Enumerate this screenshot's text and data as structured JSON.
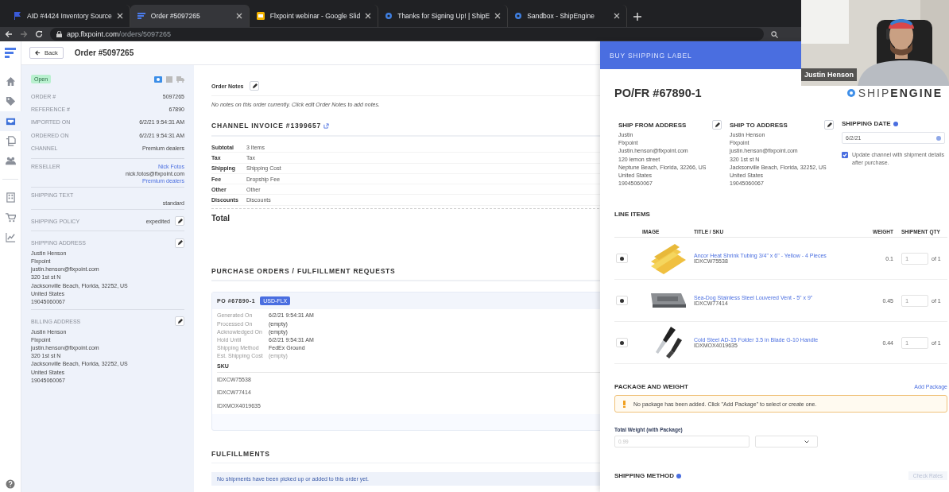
{
  "browser": {
    "tabs": [
      {
        "title": "AID #4424 Inventory Source",
        "kind": "flag",
        "selected": false
      },
      {
        "title": "Order #5097265",
        "kind": "flx",
        "selected": true
      },
      {
        "title": "Flxpoint webinar - Google Slid",
        "kind": "slides",
        "selected": false
      },
      {
        "title": "Thanks for Signing Up! | ShipE",
        "kind": "gear",
        "selected": false
      },
      {
        "title": "Sandbox - ShipEngine",
        "kind": "gear",
        "selected": false
      }
    ],
    "url_host": "app.flxpoint.com",
    "url_path": "/orders/5097265"
  },
  "rail": {
    "groups": [
      [
        {
          "kind": "home",
          "selected": false
        },
        {
          "kind": "tag",
          "selected": false
        },
        {
          "kind": "inbox",
          "selected": true
        },
        {
          "kind": "copy",
          "selected": false
        },
        {
          "kind": "users",
          "selected": false
        }
      ],
      [
        {
          "kind": "building",
          "selected": false
        },
        {
          "kind": "cart",
          "selected": false
        },
        {
          "kind": "chart",
          "selected": false
        }
      ]
    ]
  },
  "header": {
    "back": "Back",
    "title": "Order #5097265"
  },
  "details": {
    "status": "Open",
    "fields": [
      {
        "label": "ORDER #",
        "value": "5097265"
      },
      {
        "label": "REFERENCE #",
        "value": "67890"
      },
      {
        "label": "IMPORTED ON",
        "value": "6/2/21 9:54:31 AM"
      },
      {
        "label": "ORDERED ON",
        "value": "6/2/21 9:54:31 AM"
      },
      {
        "label": "CHANNEL",
        "value": "Premium dealers"
      }
    ],
    "reseller": {
      "label": "RESELLER",
      "name": "Nick Fotos",
      "email": "nick.fotos@flxpoint.com",
      "group": "Premium dealers"
    },
    "shipping_text": {
      "label": "SHIPPING TEXT",
      "value": "standard"
    },
    "shipping_policy": {
      "label": "SHIPPING POLICY",
      "value": "expedited"
    },
    "addresses": [
      {
        "label": "SHIPPING ADDRESS",
        "lines": [
          "Justin Henson",
          "Flxpoint",
          "justin.henson@flxpoint.com",
          "320 1st st N",
          "Jacksonville Beach, Florida, 32252, US",
          "United States",
          "19045060067"
        ]
      },
      {
        "label": "BILLING ADDRESS",
        "lines": [
          "Justin Henson",
          "Flxpoint",
          "justin.henson@flxpoint.com",
          "320 1st st N",
          "Jacksonville Beach, Florida, 32252, US",
          "United States",
          "19045060067"
        ]
      }
    ]
  },
  "main": {
    "order_notes": {
      "label": "Order Notes",
      "empty_text": "No notes on this order currently. Click edit Order Notes to add notes."
    },
    "invoice": {
      "title": "CHANNEL INVOICE #1399657",
      "rows": [
        {
          "label": "Subtotal",
          "value": "3 Items"
        },
        {
          "label": "Tax",
          "value": "Tax"
        },
        {
          "label": "Shipping",
          "value": "Shipping Cost"
        },
        {
          "label": "Fee",
          "value": "Dropship Fee"
        },
        {
          "label": "Other",
          "value": "Other"
        },
        {
          "label": "Discounts",
          "value": "Discounts"
        }
      ],
      "total_label": "Total"
    },
    "purchase_orders": {
      "title": "PURCHASE ORDERS / FULFILLMENT REQUESTS",
      "po": {
        "number": "PO #67890-1",
        "badge": "USD-FLX",
        "fields": [
          {
            "label": "Generated On",
            "value": "6/2/21 9:54:31 AM",
            "muted": false
          },
          {
            "label": "Processed On",
            "value": "(empty)",
            "muted": false
          },
          {
            "label": "Acknowledged On",
            "value": "(empty)",
            "muted": false
          },
          {
            "label": "Hold Until",
            "value": "6/2/21 9:54:31 AM",
            "muted": false
          },
          {
            "label": "Shipping Method",
            "value": "FedEx Ground",
            "muted": false
          },
          {
            "label": "Est. Shipping Cost",
            "value": "(empty)",
            "muted": true
          }
        ],
        "sku_header": "SKU",
        "skus": [
          "IDXCW75538",
          "IDXCW77414",
          "IDXMOX4019635"
        ]
      }
    },
    "fulfillments": {
      "title": "FULFILLMENTS",
      "empty_text": "No shipments have been picked up or added to this order yet."
    }
  },
  "drawer": {
    "title": "BUY SHIPPING LABEL",
    "po_title": "PO/FR #67890-1",
    "logo_a": "SHIP",
    "logo_b": "ENGINE",
    "ship_from": {
      "title": "SHIP FROM ADDRESS",
      "lines": [
        "Justin",
        "Flxpoint",
        "Justin.henson@flxpoint.com",
        "120 lemon street",
        "Neptune Beach, Florida, 32266, US",
        "United States",
        "19045060067"
      ]
    },
    "ship_to": {
      "title": "SHIP TO ADDRESS",
      "lines": [
        "Justin Henson",
        "Flxpoint",
        "justin.henson@flxpoint.com",
        "320 1st st N",
        "Jacksonville Beach, Florida, 32252, US",
        "United States",
        "19045060067"
      ]
    },
    "shipping_date": {
      "title": "SHIPPING DATE",
      "value": "6/2/21"
    },
    "update_channel": {
      "label": "Update channel with shipment details after purchase.",
      "checked": true
    },
    "line_items": {
      "title": "LINE ITEMS",
      "columns": [
        "IMAGE",
        "TITLE / SKU",
        "WEIGHT",
        "SHIPMENT QTY"
      ],
      "rows": [
        {
          "title": "Ancor Heat Shrink Tubing 3/4\" x 6\" - Yellow - 4 Pieces",
          "sku": "IDXCW75538",
          "weight": "0.1",
          "qty_placeholder": "1",
          "of": "of 1"
        },
        {
          "title": "Sea-Dog Stainless Steel Louvered Vent - 5\" x 9\"",
          "sku": "IDXCW77414",
          "weight": "0.45",
          "qty_placeholder": "1",
          "of": "of 1"
        },
        {
          "title": "Cold Steel AD-15 Folder 3.5 in Blade G-10 Handle",
          "sku": "IDXMOX4019635",
          "weight": "0.44",
          "qty_placeholder": "1",
          "of": "of 1"
        }
      ]
    },
    "package": {
      "title": "PACKAGE AND WEIGHT",
      "add_link": "Add Package",
      "warning": "No package has been added. Click \"Add Package\" to select or create one.",
      "weight_label": "Total Weight (with Package)",
      "weight_placeholder": "0.99"
    },
    "shipping_method": {
      "title": "SHIPPING METHOD",
      "check_rates": "Check Rates"
    }
  },
  "video": {
    "caption": "Justin Henson"
  }
}
